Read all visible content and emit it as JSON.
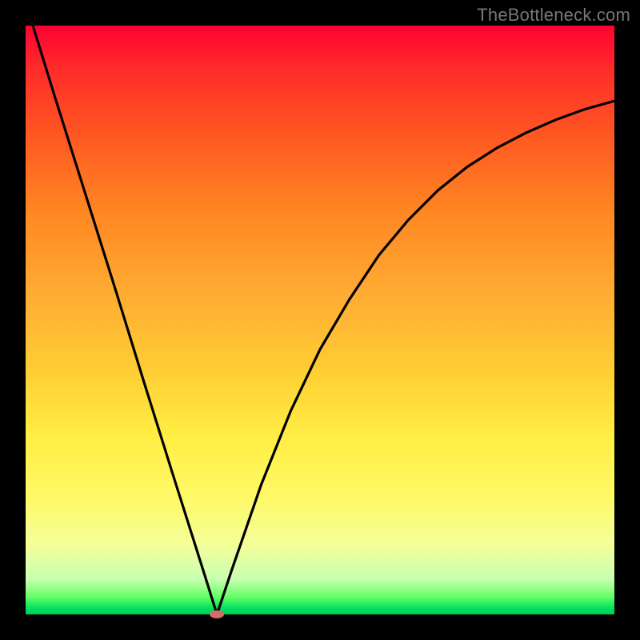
{
  "watermark": "TheBottleneck.com",
  "colors": {
    "curve": "#000000",
    "min_marker": "#d96a6a",
    "frame": "#000000"
  },
  "chart_data": {
    "type": "line",
    "title": "",
    "xlabel": "",
    "ylabel": "",
    "xlim": [
      0,
      1
    ],
    "ylim": [
      0,
      1
    ],
    "annotations": [],
    "min_marker": {
      "x": 0.325,
      "y": 0.0
    },
    "series": [
      {
        "name": "bottleneck-curve",
        "x": [
          0.0,
          0.05,
          0.1,
          0.15,
          0.2,
          0.25,
          0.3,
          0.325,
          0.35,
          0.4,
          0.45,
          0.5,
          0.55,
          0.6,
          0.65,
          0.7,
          0.75,
          0.8,
          0.85,
          0.9,
          0.95,
          1.0
        ],
        "y": [
          1.04,
          0.878,
          0.719,
          0.56,
          0.398,
          0.238,
          0.08,
          0.0,
          0.075,
          0.22,
          0.345,
          0.45,
          0.535,
          0.61,
          0.67,
          0.72,
          0.76,
          0.792,
          0.818,
          0.84,
          0.858,
          0.872
        ]
      }
    ]
  }
}
